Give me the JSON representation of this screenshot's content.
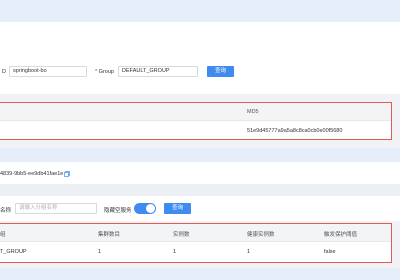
{
  "config_search": {
    "dataid_label": "D",
    "dataid_value": "springboot-bo",
    "required_mark": "*",
    "group_label": "Group",
    "group_value": "DEFAULT_GROUP",
    "query_label": "查询"
  },
  "config_table": {
    "md5_header": "MD5",
    "md5_value": "51e9d45777a9a5a8c8ca0cb0e00f5680"
  },
  "namespace": {
    "id_text": "4839-9bb5-ee9db41fae1e"
  },
  "service_search": {
    "name_label": "名称",
    "name_placeholder": "请输入分组名称",
    "hide_empty_label": "隐藏空服务",
    "hide_empty_on": true,
    "query_label": "查询"
  },
  "service_table": {
    "headers": [
      "组",
      "集群数目",
      "实例数",
      "健康实例数",
      "触发保护阈值"
    ],
    "rows": [
      [
        "T_GROUP",
        "1",
        "1",
        "1",
        "false"
      ]
    ]
  },
  "colors": {
    "accent": "#3f8bf0",
    "highlight_border": "#e15b55"
  }
}
